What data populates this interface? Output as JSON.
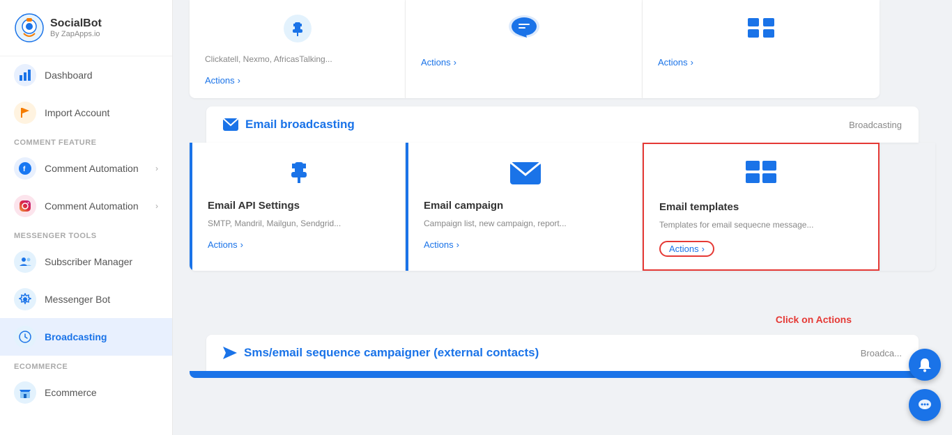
{
  "logo": {
    "name": "SocialBot",
    "sub": "By ZapApps.io"
  },
  "sidebar": {
    "sections": [
      {
        "items": [
          {
            "id": "dashboard",
            "label": "Dashboard",
            "icon": "chart",
            "active": false
          },
          {
            "id": "import-account",
            "label": "Import Account",
            "icon": "flag",
            "active": false
          }
        ]
      },
      {
        "label": "COMMENT FEATURE",
        "items": [
          {
            "id": "comment-auto-fb",
            "label": "Comment Automation",
            "icon": "facebook",
            "active": false,
            "chevron": true
          },
          {
            "id": "comment-auto-ig",
            "label": "Comment Automation",
            "icon": "instagram",
            "active": false,
            "chevron": true
          }
        ]
      },
      {
        "label": "MESSENGER TOOLS",
        "items": [
          {
            "id": "subscriber-manager",
            "label": "Subscriber Manager",
            "icon": "users",
            "active": false
          },
          {
            "id": "messenger-bot",
            "label": "Messenger Bot",
            "icon": "gear",
            "active": false
          },
          {
            "id": "broadcasting",
            "label": "Broadcasting",
            "icon": "clock",
            "active": true
          }
        ]
      },
      {
        "label": "ECOMMERCE",
        "items": [
          {
            "id": "ecommerce",
            "label": "Ecommerce",
            "icon": "store",
            "active": false
          }
        ]
      }
    ]
  },
  "top_partial_section": {
    "cards": [
      {
        "id": "sms-api",
        "desc": "Clickatell, Nexmo, AfricasTalking...",
        "action": "Actions"
      },
      {
        "id": "card2",
        "action": "Actions"
      },
      {
        "id": "card3",
        "action": "Actions"
      }
    ]
  },
  "email_broadcasting": {
    "section_title": "Email broadcasting",
    "section_badge": "Broadcasting",
    "cards": [
      {
        "id": "email-api-settings",
        "title": "Email API Settings",
        "desc": "SMTP, Mandril, Mailgun, Sendgrid...",
        "action": "Actions",
        "left_accent": true
      },
      {
        "id": "email-campaign",
        "title": "Email campaign",
        "desc": "Campaign list, new campaign, report...",
        "action": "Actions",
        "left_accent": true
      },
      {
        "id": "email-templates",
        "title": "Email templates",
        "desc": "Templates for email sequecne message...",
        "action": "Actions",
        "highlighted": true
      }
    ]
  },
  "click_annotation": {
    "label": "Click on Actions"
  },
  "sms_sequence": {
    "section_title": "Sms/email sequence campaigner (external contacts)",
    "section_badge": "Broadca..."
  },
  "icons": {
    "chart": "📊",
    "flag": "🚩",
    "facebook": "f",
    "instagram": "📷",
    "users": "👥",
    "gear": "⚙",
    "clock": "🕐",
    "store": "🛒",
    "email": "✉",
    "plug": "🔌",
    "table": "▦",
    "bell": "🔔",
    "chat": "💬",
    "send": "➤"
  }
}
